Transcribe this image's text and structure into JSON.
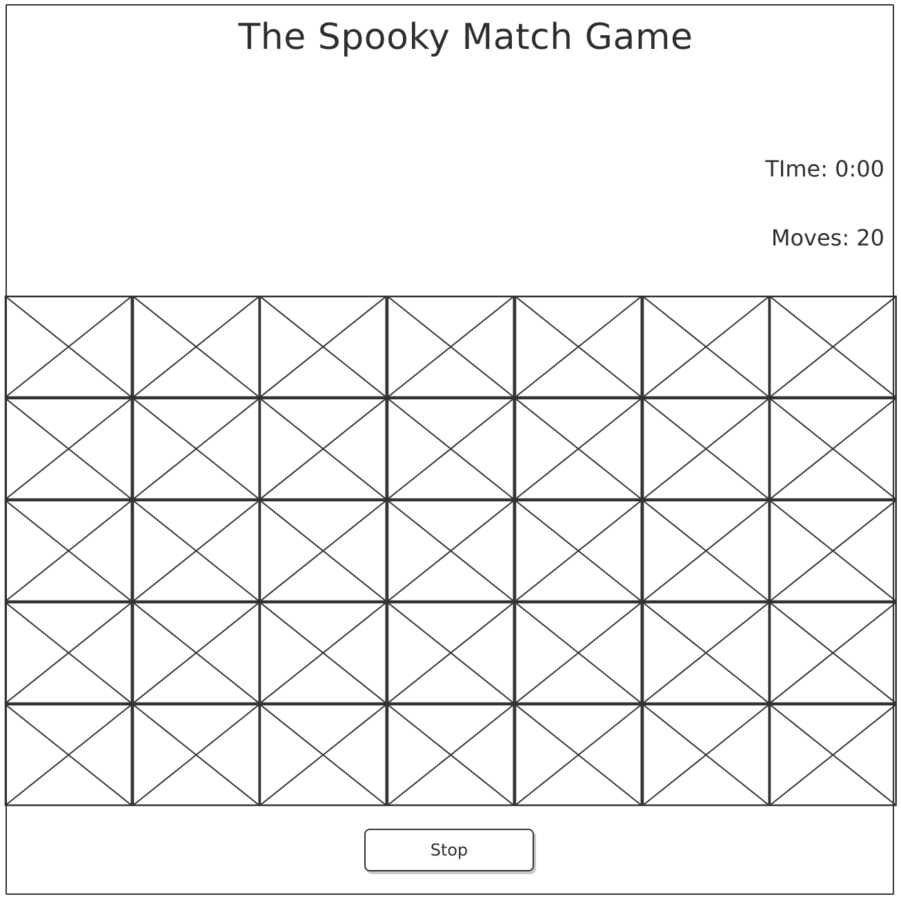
{
  "header": {
    "title": "The Spooky Match Game"
  },
  "stats": {
    "time": "TIme: 0:00",
    "moves": "Moves: 20"
  },
  "board": {
    "rows": 5,
    "columns": 7,
    "card_state": "face-down placeholder"
  },
  "controls": {
    "stop_label": "Stop"
  },
  "colors": {
    "ink": "#333333",
    "background": "#ffffff",
    "button_shadow": "#c9c9c9"
  }
}
